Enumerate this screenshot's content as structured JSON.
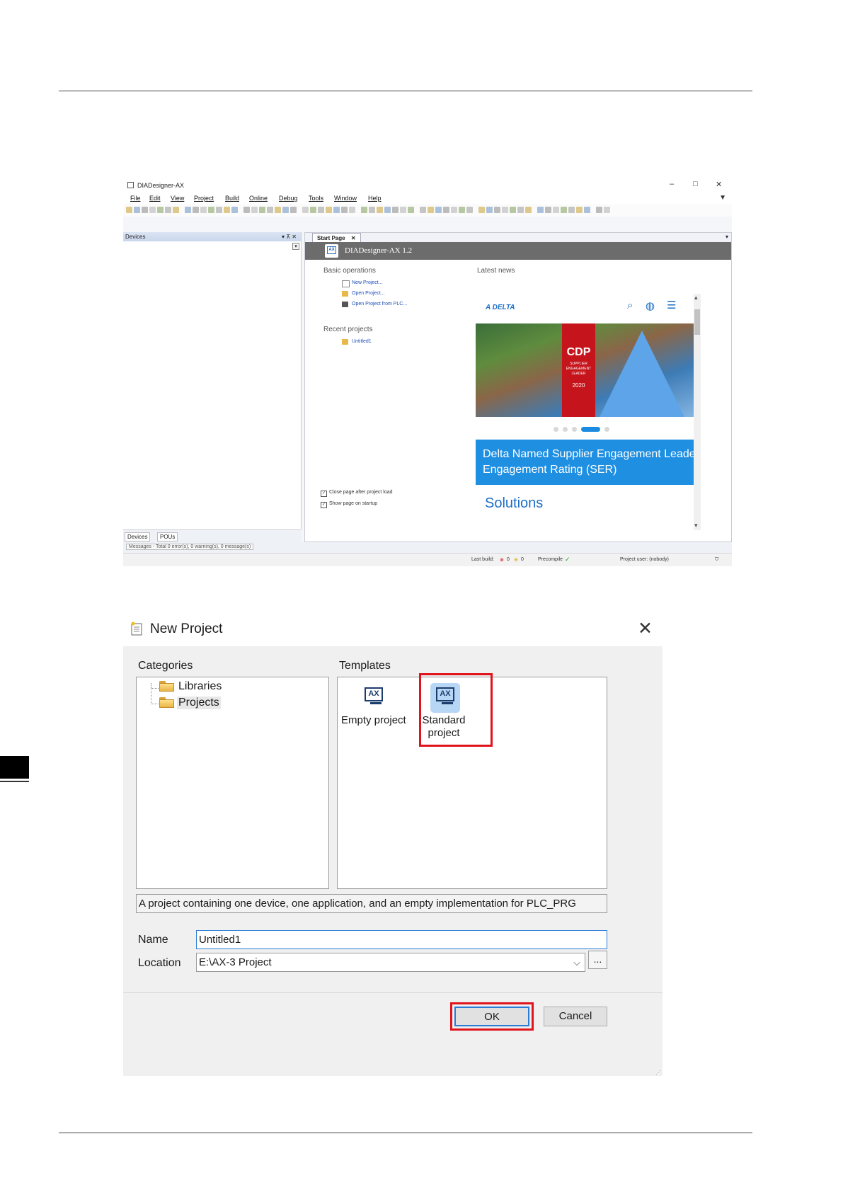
{
  "ide": {
    "app_title": "DIADesigner-AX",
    "window_controls": [
      "–",
      "□",
      "✕"
    ],
    "menu": [
      "File",
      "Edit",
      "View",
      "Project",
      "Build",
      "Online",
      "Debug",
      "Tools",
      "Window",
      "Help"
    ],
    "devices_panel_title": "Devices",
    "devices_panel_controls": "▾  ⊼  ✕",
    "bottom_tabs": [
      "Devices",
      "POUs"
    ],
    "messages": "Messages - Total 0 error(s), 0 warning(s), 0 message(s)",
    "start_tab": "Start Page",
    "start_tab_close": "✕",
    "banner_title": "DIADesigner-AX 1.2",
    "basic_operations": "Basic operations",
    "ops": [
      "New Project...",
      "Open Project...",
      "Open Project from PLC..."
    ],
    "recent_projects": "Recent projects",
    "recent": [
      "Untitled1"
    ],
    "close_page_option": "Close page after project load",
    "show_page_option": "Show page on startup",
    "latest_news": "Latest news",
    "news_logo": "A DELTA",
    "cdp_badge": {
      "title": "CDP",
      "line1": "SUPPLIER",
      "line2": "ENGAGEMENT",
      "line3": "LEADER",
      "year": "2020"
    },
    "news_headline_1": "Delta Named Supplier Engagement Leade",
    "news_headline_2": "Engagement Rating (SER)",
    "solutions": "Solutions",
    "status_last_build": "Last build:",
    "status_errors": "0",
    "status_warnings": "0",
    "status_precompile": "Precompile",
    "status_user": "Project user: (nobody)"
  },
  "dialog": {
    "title": "New Project",
    "categories_label": "Categories",
    "templates_label": "Templates",
    "categories": [
      "Libraries",
      "Projects"
    ],
    "templates": [
      {
        "label_1": "Empty project",
        "label_2": ""
      },
      {
        "label_1": "Standard",
        "label_2": "project"
      }
    ],
    "template_icon_text": "AX",
    "description": "A project containing one device, one application, and an empty implementation for PLC_PRG",
    "name_label": "Name",
    "name_value": "Untitled1",
    "location_label": "Location",
    "location_value": "E:\\AX-3 Project",
    "browse_label": "...",
    "ok_label": "OK",
    "cancel_label": "Cancel"
  },
  "colors": {
    "highlight": "#e0141c",
    "news_blue": "#1f8fe2",
    "accent": "#2a7bd6"
  }
}
